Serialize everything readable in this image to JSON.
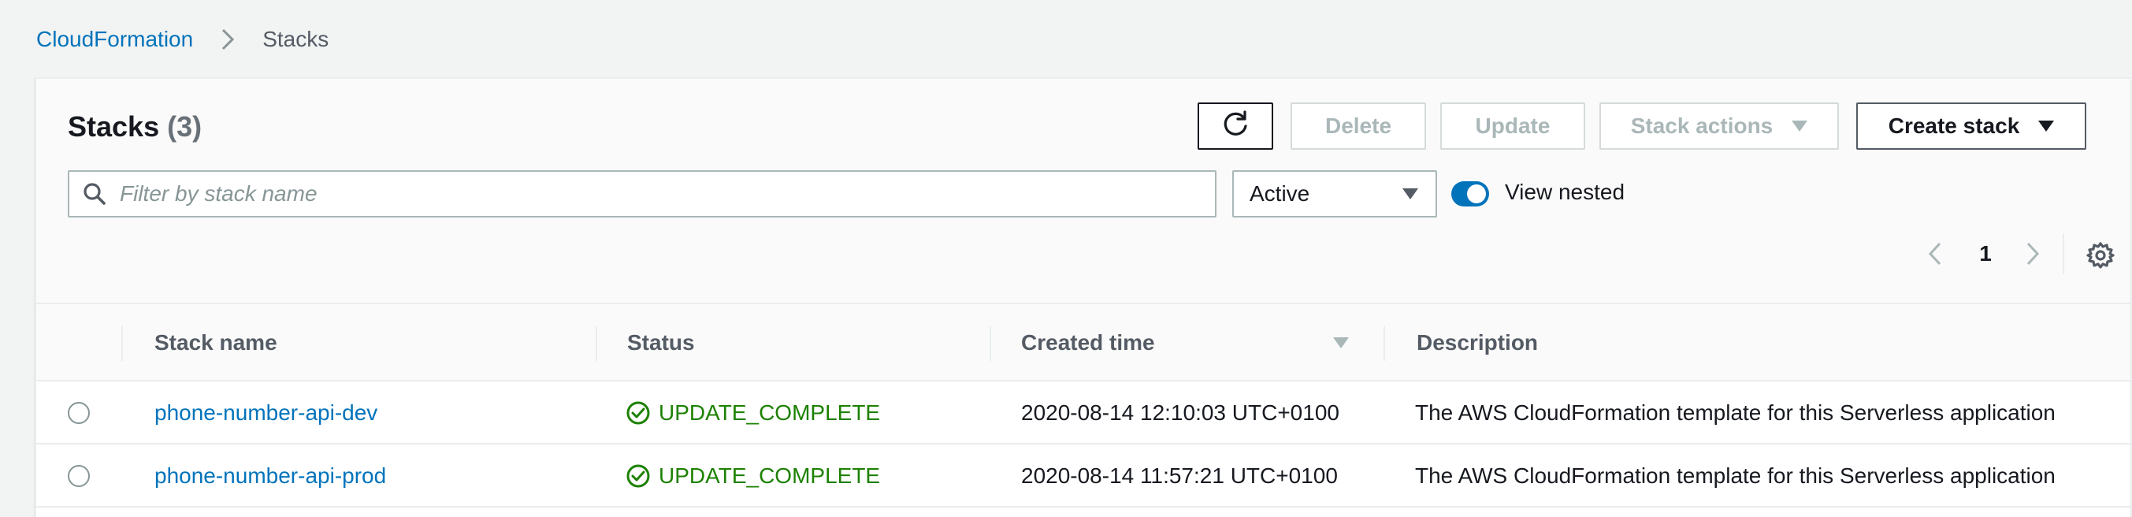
{
  "breadcrumb": {
    "parent": "CloudFormation",
    "current": "Stacks"
  },
  "header": {
    "title": "Stacks",
    "count": "(3)"
  },
  "toolbar": {
    "delete_label": "Delete",
    "update_label": "Update",
    "stack_actions_label": "Stack actions",
    "create_stack_label": "Create stack"
  },
  "filter": {
    "placeholder": "Filter by stack name",
    "value": ""
  },
  "status_filter": {
    "selected": "Active"
  },
  "view_nested": {
    "label": "View nested",
    "enabled": true
  },
  "pagination": {
    "current_page": "1"
  },
  "table": {
    "columns": [
      "Stack name",
      "Status",
      "Created time",
      "Description"
    ],
    "rows": [
      {
        "name": "phone-number-api-dev",
        "status": "UPDATE_COMPLETE",
        "created": "2020-08-14 12:10:03 UTC+0100",
        "description": "The AWS CloudFormation template for this Serverless application"
      },
      {
        "name": "phone-number-api-prod",
        "status": "UPDATE_COMPLETE",
        "created": "2020-08-14 11:57:21 UTC+0100",
        "description": "The AWS CloudFormation template for this Serverless application"
      }
    ]
  },
  "colors": {
    "link": "#0073bb",
    "success": "#1d8102",
    "toggle_on": "#0073bb"
  },
  "icons": {
    "refresh": "refresh-icon",
    "search": "search-icon",
    "settings": "gear-icon",
    "status_ok": "check-circle-icon"
  }
}
